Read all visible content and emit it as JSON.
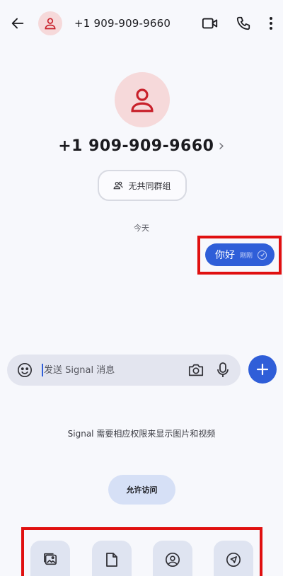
{
  "header": {
    "title": "+1 909-909-9660",
    "icons": [
      "back-arrow-icon",
      "person-icon",
      "video-call-icon",
      "phone-icon",
      "more-vertical-icon"
    ]
  },
  "contact": {
    "name": "+1 909-909-9660",
    "chevron": "›",
    "groups_label": "无共同群组"
  },
  "conversation": {
    "date_divider": "今天",
    "messages": [
      {
        "text": "你好",
        "time": "刚刚",
        "outgoing": true
      }
    ]
  },
  "composer": {
    "placeholder": "发送 Signal 消息"
  },
  "attachments": {
    "permission_text": "Signal 需要相应权限来显示图片和视频",
    "allow_label": "允许访问",
    "options": [
      "gallery-icon",
      "file-icon",
      "contact-icon",
      "location-icon"
    ]
  },
  "colors": {
    "accent": "#2f5ed8",
    "avatar_bg": "#f6d9da",
    "avatar_fg": "#c8202a",
    "highlight": "#e01010"
  }
}
